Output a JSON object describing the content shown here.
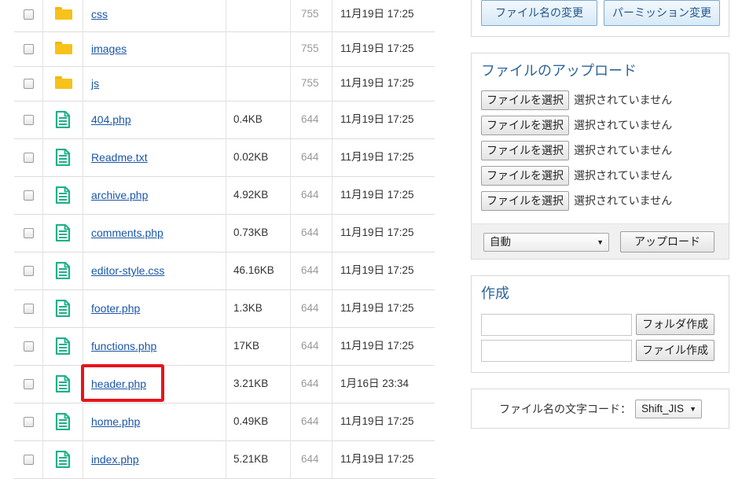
{
  "files": [
    {
      "type": "folder",
      "name": "css",
      "size": "",
      "perm": "755",
      "date": "11月19日 17:25"
    },
    {
      "type": "folder",
      "name": "images",
      "size": "",
      "perm": "755",
      "date": "11月19日 17:25"
    },
    {
      "type": "folder",
      "name": "js",
      "size": "",
      "perm": "755",
      "date": "11月19日 17:25"
    },
    {
      "type": "file",
      "name": "404.php",
      "size": "0.4KB",
      "perm": "644",
      "date": "11月19日 17:25"
    },
    {
      "type": "file",
      "name": "Readme.txt",
      "size": "0.02KB",
      "perm": "644",
      "date": "11月19日 17:25"
    },
    {
      "type": "file",
      "name": "archive.php",
      "size": "4.92KB",
      "perm": "644",
      "date": "11月19日 17:25"
    },
    {
      "type": "file",
      "name": "comments.php",
      "size": "0.73KB",
      "perm": "644",
      "date": "11月19日 17:25"
    },
    {
      "type": "file",
      "name": "editor-style.css",
      "size": "46.16KB",
      "perm": "644",
      "date": "11月19日 17:25"
    },
    {
      "type": "file",
      "name": "footer.php",
      "size": "1.3KB",
      "perm": "644",
      "date": "11月19日 17:25"
    },
    {
      "type": "file",
      "name": "functions.php",
      "size": "17KB",
      "perm": "644",
      "date": "11月19日 17:25"
    },
    {
      "type": "file",
      "name": "header.php",
      "size": "3.21KB",
      "perm": "644",
      "date": "1月16日 23:34",
      "highlighted": true
    },
    {
      "type": "file",
      "name": "home.php",
      "size": "0.49KB",
      "perm": "644",
      "date": "11月19日 17:25"
    },
    {
      "type": "file",
      "name": "index.php",
      "size": "5.21KB",
      "perm": "644",
      "date": "11月19日 17:25"
    }
  ],
  "actions": {
    "rename_label": "ファイル名の変更",
    "permission_label": "パーミッション変更"
  },
  "upload": {
    "title": "ファイルのアップロード",
    "choose_label": "ファイルを選択",
    "no_file_label": "選択されていません",
    "slot_count_visible": 5,
    "mode_value": "自動",
    "submit_label": "アップロード"
  },
  "create": {
    "title": "作成",
    "folder_button": "フォルダ作成",
    "file_button": "ファイル作成"
  },
  "encoding": {
    "label": "ファイル名の文字コード：",
    "value": "Shift_JIS"
  },
  "colors": {
    "link": "#1a56a8",
    "title": "#2f6597",
    "folder": "#f7c21a",
    "file_icon": "#1fb08a",
    "highlight": "#e8141c",
    "permission_text": "#999999"
  },
  "icons": {
    "folder": "folder-icon",
    "file": "document-icon",
    "dropdown": "chevron-down-icon"
  }
}
